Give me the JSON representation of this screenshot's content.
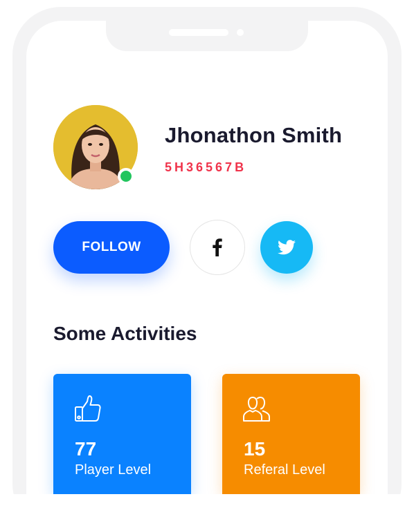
{
  "profile": {
    "name": "Jhonathon Smith",
    "code": "5H36567B",
    "status": "online"
  },
  "actions": {
    "follow_label": "FOLLOW",
    "facebook_icon": "facebook-icon",
    "twitter_icon": "twitter-icon"
  },
  "activities": {
    "title": "Some Activities",
    "cards": [
      {
        "value": "77",
        "label": "Player Level",
        "icon": "thumbs-up-icon",
        "color": "#0a82ff"
      },
      {
        "value": "15",
        "label": "Referal Level",
        "icon": "users-icon",
        "color": "#f68c00"
      }
    ]
  },
  "colors": {
    "primary": "#0b5cff",
    "accent_red": "#f0334b",
    "online": "#22c55e",
    "twitter": "#16b9f5"
  }
}
